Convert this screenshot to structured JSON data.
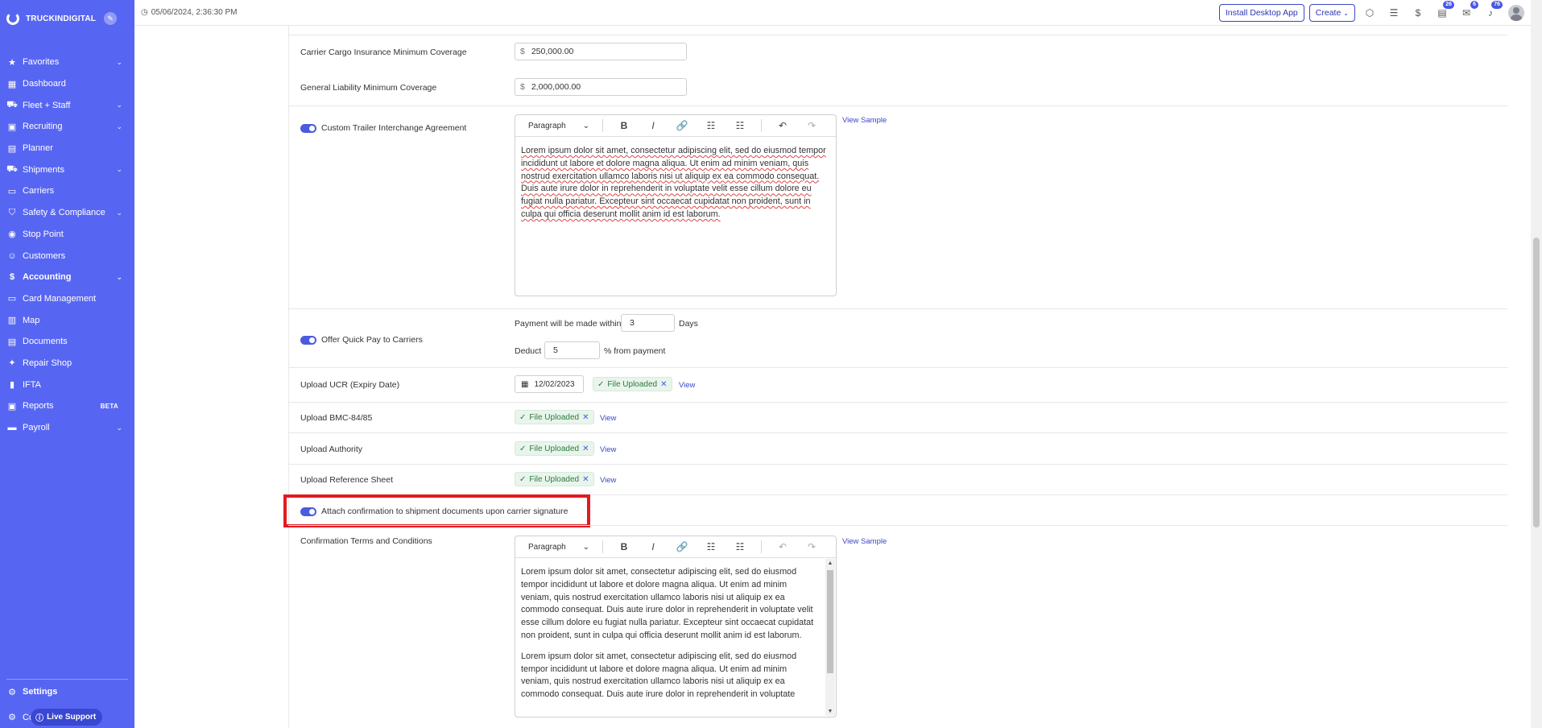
{
  "app": {
    "brand": "TRUCKINDIGITAL",
    "datetime": "05/06/2024, 2:36:30 PM"
  },
  "sidebar": {
    "items": [
      {
        "label": "Favorites",
        "icon": "star-icon",
        "chevron": true
      },
      {
        "label": "Dashboard",
        "icon": "dashboard-icon",
        "chevron": false
      },
      {
        "label": "Fleet + Staff",
        "icon": "fleet-icon",
        "chevron": true
      },
      {
        "label": "Recruiting",
        "icon": "recruiting-icon",
        "chevron": true
      },
      {
        "label": "Planner",
        "icon": "planner-icon",
        "chevron": false
      },
      {
        "label": "Shipments",
        "icon": "shipments-icon",
        "chevron": true
      },
      {
        "label": "Carriers",
        "icon": "carriers-icon",
        "chevron": false
      },
      {
        "label": "Safety & Compliance",
        "icon": "shield-icon",
        "chevron": true
      },
      {
        "label": "Stop Point",
        "icon": "pin-icon",
        "chevron": false
      },
      {
        "label": "Customers",
        "icon": "customers-icon",
        "chevron": false
      },
      {
        "label": "Accounting",
        "icon": "dollar-icon",
        "chevron": true,
        "active": true
      },
      {
        "label": "Card Management",
        "icon": "card-icon",
        "chevron": false
      },
      {
        "label": "Map",
        "icon": "map-icon",
        "chevron": false
      },
      {
        "label": "Documents",
        "icon": "documents-icon",
        "chevron": false
      },
      {
        "label": "Repair Shop",
        "icon": "wrench-icon",
        "chevron": false
      },
      {
        "label": "IFTA",
        "icon": "fuel-icon",
        "chevron": false
      },
      {
        "label": "Reports",
        "icon": "reports-icon",
        "chevron": false,
        "badge": "BETA"
      },
      {
        "label": "Payroll",
        "icon": "payroll-icon",
        "chevron": true
      }
    ],
    "settings_label": "Settings",
    "covered_label": "Co",
    "live_support_label": "Live Support"
  },
  "topbar": {
    "install_label": "Install Desktop App",
    "create_label": "Create",
    "badges": {
      "tasks": "26",
      "messages": "6",
      "notifications": "76"
    }
  },
  "form": {
    "cargo_label": "Carrier Cargo Insurance Minimum Coverage",
    "cargo_value": "250,000.00",
    "liability_label": "General Liability Minimum Coverage",
    "liability_value": "2,000,000.00",
    "currency": "$",
    "trailer_label": "Custom Trailer Interchange Agreement",
    "view_sample": "View Sample",
    "paragraph": "Paragraph",
    "quickpay_label": "Offer Quick Pay to Carriers",
    "payment_within": "Payment will be made within",
    "payment_days_value": "3",
    "days": "Days",
    "deduct": "Deduct",
    "deduct_value": "5",
    "from_payment": "% from payment",
    "ucr_label": "Upload UCR (Expiry Date)",
    "ucr_date": "12/02/2023",
    "file_uploaded": "File Uploaded",
    "view": "View",
    "bmc_label": "Upload BMC-84/85",
    "authority_label": "Upload Authority",
    "reference_label": "Upload Reference Sheet",
    "attach_label": "Attach confirmation to shipment documents upon carrier signature",
    "terms_label": "Confirmation Terms and Conditions",
    "lorem": "Lorem ipsum dolor sit amet, consectetur adipiscing elit, sed do eiusmod tempor incididunt ut labore et dolore magna aliqua. Ut enim ad minim veniam, quis nostrud exercitation ullamco laboris nisi ut aliquip ex ea commodo consequat. Duis aute irure dolor in reprehenderit in voluptate velit esse cillum dolore eu fugiat nulla pariatur. Excepteur sint occaecat cupidatat non proident, sunt in culpa qui officia deserunt mollit anim id est laborum.",
    "lorem2": "Lorem ipsum dolor sit amet, consectetur adipiscing elit, sed do eiusmod tempor incididunt ut labore et dolore magna aliqua. Ut enim ad minim veniam, quis nostrud exercitation ullamco laboris nisi ut aliquip ex ea commodo consequat. Duis aute irure dolor in reprehenderit in voluptate"
  },
  "colors": {
    "sidebar": "#5766f2",
    "accent": "#3b46c8",
    "highlight": "#e11b22",
    "uploaded": "#2d7a3a"
  }
}
